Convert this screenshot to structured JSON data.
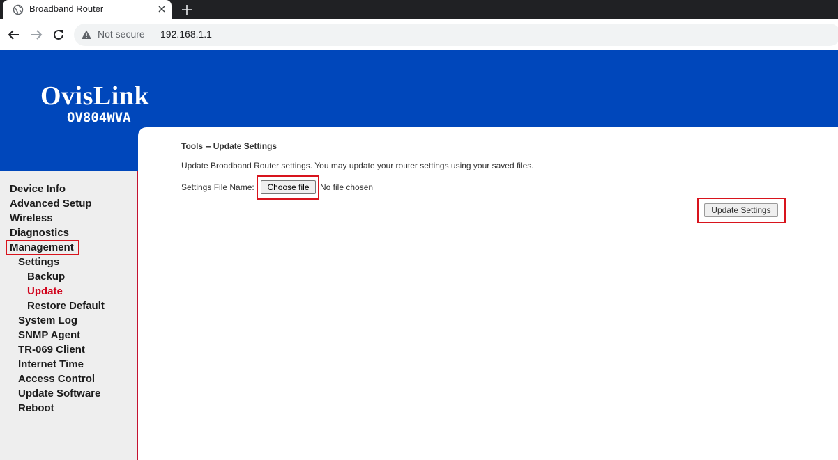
{
  "browser": {
    "tab_title": "Broadband Router",
    "security_label": "Not secure",
    "url": "192.168.1.1",
    "icons": [
      "globe-icon",
      "close-icon",
      "plus-icon",
      "back-arrow-icon",
      "forward-arrow-icon",
      "reload-icon",
      "warning-icon"
    ]
  },
  "brand": {
    "name": "OvisLink",
    "model": "OV804WVA",
    "colors": {
      "banner": "#0047bb",
      "accent": "#c41230",
      "highlight": "#d8141d"
    }
  },
  "sidebar": {
    "items": [
      {
        "label": "Device Info"
      },
      {
        "label": "Advanced Setup"
      },
      {
        "label": "Wireless"
      },
      {
        "label": "Diagnostics"
      },
      {
        "label": "Management"
      },
      {
        "label": "Settings"
      },
      {
        "label": "Backup"
      },
      {
        "label": "Update"
      },
      {
        "label": "Restore Default"
      },
      {
        "label": "System Log"
      },
      {
        "label": "SNMP Agent"
      },
      {
        "label": "TR-069 Client"
      },
      {
        "label": "Internet Time"
      },
      {
        "label": "Access Control"
      },
      {
        "label": "Update Software"
      },
      {
        "label": "Reboot"
      }
    ]
  },
  "main": {
    "heading": "Tools -- Update Settings",
    "description": "Update Broadband Router settings. You may update your router settings using your saved files.",
    "file_label": "Settings File Name:",
    "choose_button": "Choose file",
    "file_status": "No file chosen",
    "update_button": "Update Settings"
  }
}
